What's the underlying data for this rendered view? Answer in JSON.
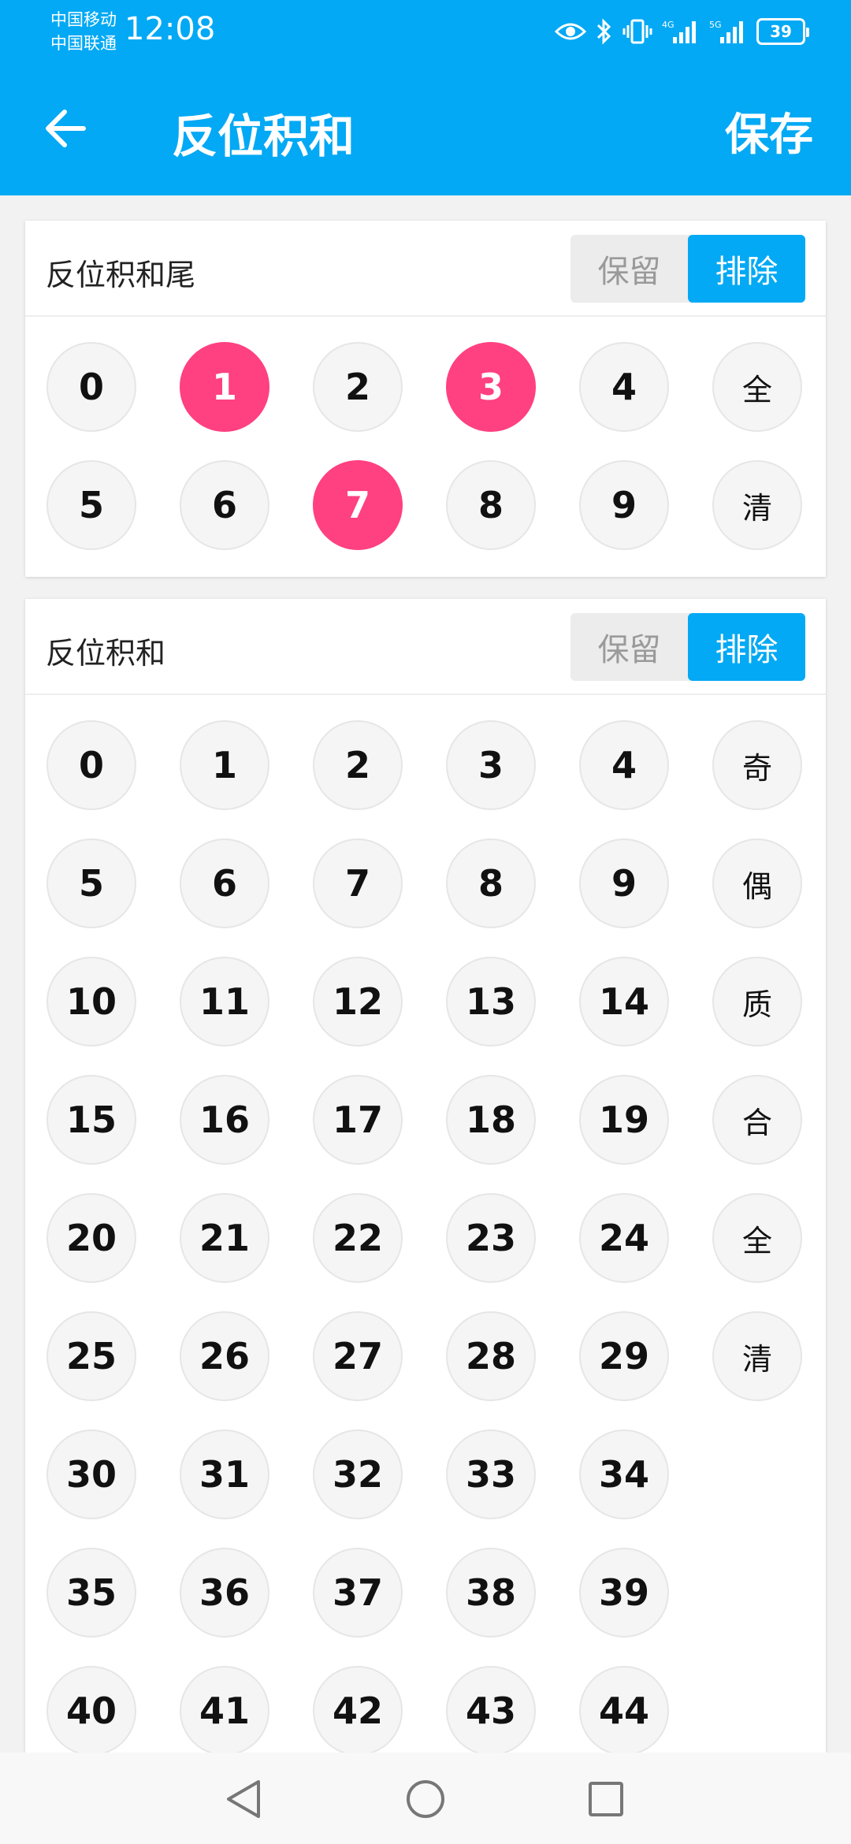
{
  "status_bar": {
    "carrier_1": "中国移动",
    "carrier_2": "中国联通",
    "time": "12:08",
    "net_1": "4G",
    "net_2": "5G",
    "battery": "39"
  },
  "header": {
    "title": "反位积和",
    "save_label": "保存",
    "back_icon": "arrow-left-icon"
  },
  "colors": {
    "primary": "#03A9F4",
    "selected": "#FF4081",
    "ball_bg": "#f5f5f5"
  },
  "section_tail": {
    "title": "反位积和尾",
    "keep_label": "保留",
    "exclude_label": "排除",
    "active_mode": "排除",
    "numbers": [
      {
        "label": "0",
        "selected": false
      },
      {
        "label": "1",
        "selected": true
      },
      {
        "label": "2",
        "selected": false
      },
      {
        "label": "3",
        "selected": true
      },
      {
        "label": "4",
        "selected": false
      },
      {
        "label": "5",
        "selected": false
      },
      {
        "label": "6",
        "selected": false
      },
      {
        "label": "7",
        "selected": true
      },
      {
        "label": "8",
        "selected": false
      },
      {
        "label": "9",
        "selected": false
      }
    ],
    "functions": [
      "全",
      "清"
    ]
  },
  "section_sum": {
    "title": "反位积和",
    "keep_label": "保留",
    "exclude_label": "排除",
    "active_mode": "排除",
    "numbers": [
      "0",
      "1",
      "2",
      "3",
      "4",
      "5",
      "6",
      "7",
      "8",
      "9",
      "10",
      "11",
      "12",
      "13",
      "14",
      "15",
      "16",
      "17",
      "18",
      "19",
      "20",
      "21",
      "22",
      "23",
      "24",
      "25",
      "26",
      "27",
      "28",
      "29",
      "30",
      "31",
      "32",
      "33",
      "34",
      "35",
      "36",
      "37",
      "38",
      "39",
      "40",
      "41",
      "42",
      "43",
      "44"
    ],
    "functions": [
      "奇",
      "偶",
      "质",
      "合",
      "全",
      "清"
    ]
  },
  "nav_bar": {
    "icons": [
      "back-triangle-icon",
      "home-circle-icon",
      "recents-square-icon"
    ]
  }
}
